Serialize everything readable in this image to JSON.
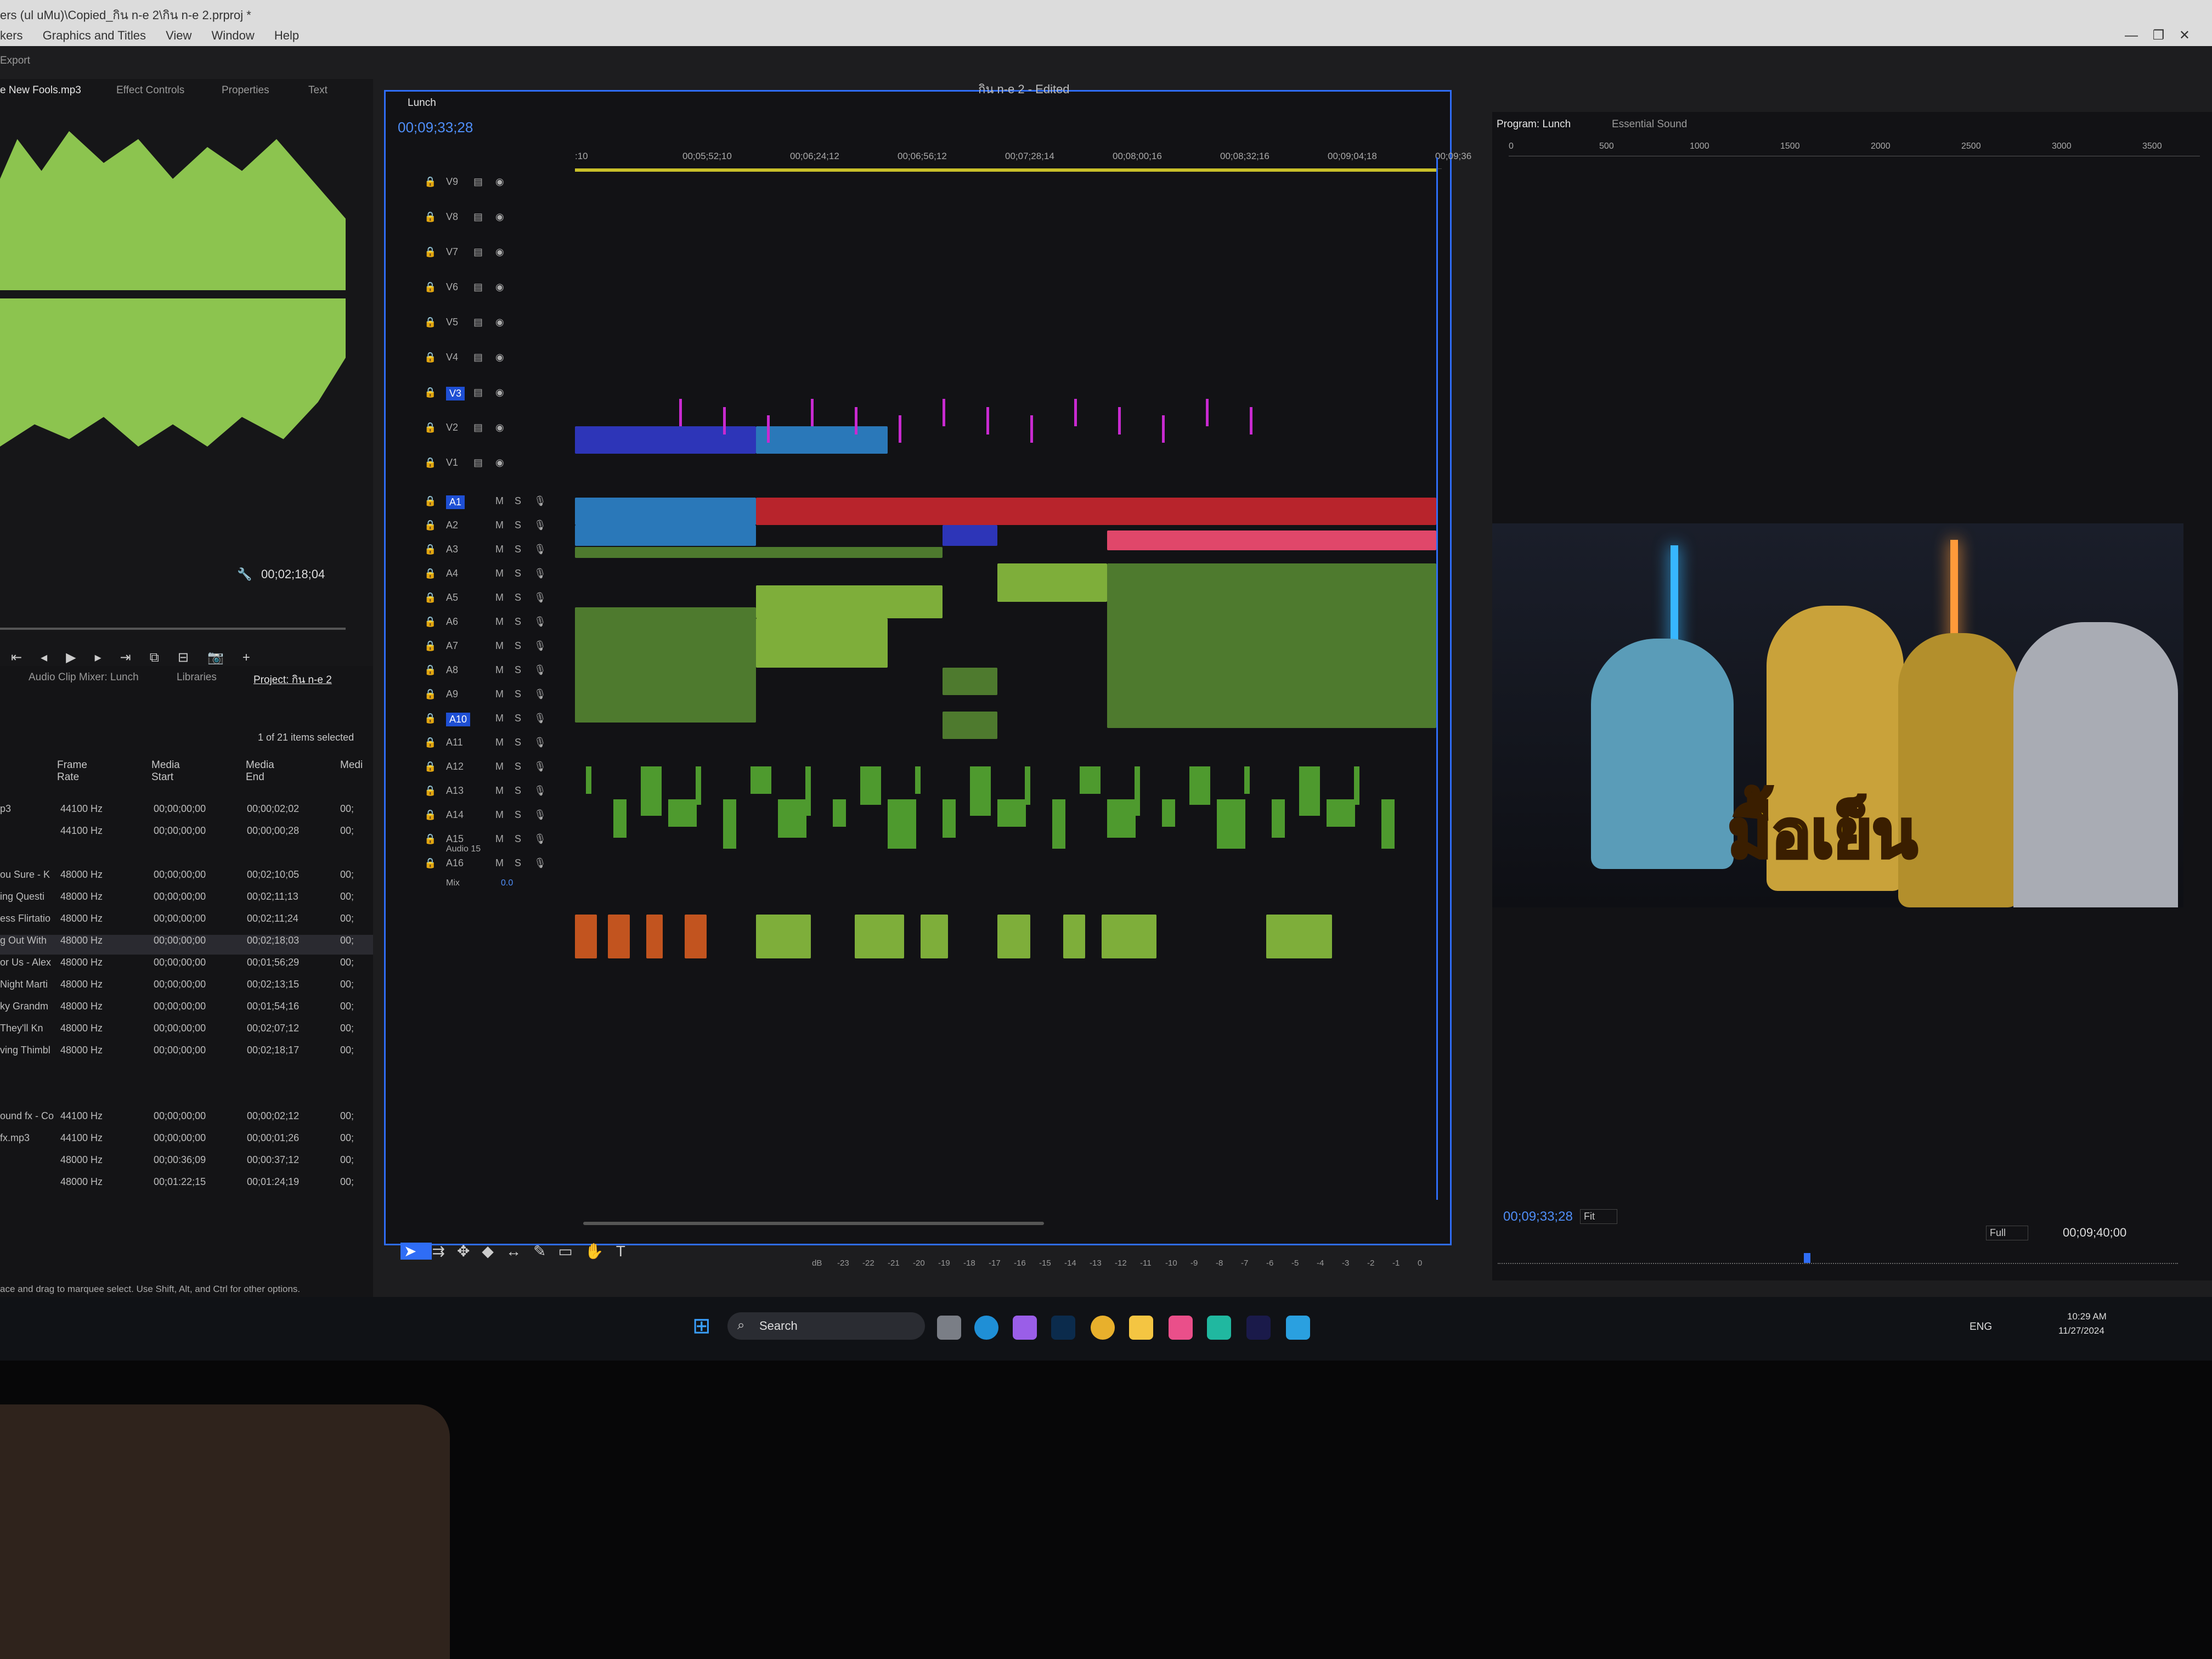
{
  "window": {
    "title": "ers (ul uMu)\\Copied_กิน n-e 2\\กิน n-e 2.prproj *",
    "menus": [
      "kers",
      "Graphics and Titles",
      "View",
      "Window",
      "Help"
    ],
    "export_label": "Export"
  },
  "source_panel": {
    "tabs": [
      "e New Fools.mp3",
      "Effect Controls",
      "Properties",
      "Text"
    ],
    "timecode": "00;02;18;04"
  },
  "timeline": {
    "tab": "Lunch",
    "title": "กิน n-e 2 - Edited",
    "timecode": "00;09;33;28",
    "ruler": [
      ":10",
      "00;05;52;10",
      "00;06;24;12",
      "00;06;56;12",
      "00;07;28;14",
      "00;08;00;16",
      "00;08;32;16",
      "00;09;04;18",
      "00;09;36"
    ],
    "video_tracks": [
      "V9",
      "V8",
      "V7",
      "V6",
      "V5",
      "V4",
      "V3",
      "V2",
      "V1"
    ],
    "audio_tracks": [
      "A1",
      "A2",
      "A3",
      "A4",
      "A5",
      "A6",
      "A7",
      "A8",
      "A9",
      "A10",
      "A11",
      "A12",
      "A13",
      "A14",
      "A15",
      "A16"
    ],
    "audio15_name": "Audio 15",
    "mix_label": "Mix",
    "mix_value": "0.0",
    "ms": [
      "M",
      "S"
    ]
  },
  "program": {
    "tabs": [
      "Program: Lunch",
      "Essential Sound"
    ],
    "ruler": [
      "0",
      "500",
      "1000",
      "1500",
      "2000",
      "2500",
      "3000",
      "3500"
    ],
    "timecode": "00;09;33;28",
    "fit": "Fit",
    "resolution": "Full",
    "duration": "00;09;40;00",
    "overlay_text": "มื้อเย็น"
  },
  "project": {
    "tabs": [
      "Audio Clip Mixer: Lunch",
      "Libraries",
      "Project: กิน n-e 2"
    ],
    "selection": "1 of 21 items selected",
    "columns": [
      "Frame Rate",
      "Media Start",
      "Media End",
      "Medi"
    ],
    "rows": [
      {
        "name": "p3",
        "rate": "44100 Hz",
        "start": "00;00;00;00",
        "end": "00;00;02;02",
        "x": "00;"
      },
      {
        "name": "",
        "rate": "44100 Hz",
        "start": "00;00;00;00",
        "end": "00;00;00;28",
        "x": "00;"
      },
      {
        "name": "ou Sure - K",
        "rate": "48000 Hz",
        "start": "00;00;00;00",
        "end": "00;02;10;05",
        "x": "00;"
      },
      {
        "name": "ing Questi",
        "rate": "48000 Hz",
        "start": "00;00;00;00",
        "end": "00;02;11;13",
        "x": "00;"
      },
      {
        "name": "ess Flirtatio",
        "rate": "48000 Hz",
        "start": "00;00;00;00",
        "end": "00;02;11;24",
        "x": "00;"
      },
      {
        "name": "g Out With",
        "rate": "48000 Hz",
        "start": "00;00;00;00",
        "end": "00;02;18;03",
        "x": "00;"
      },
      {
        "name": "or Us - Alex",
        "rate": "48000 Hz",
        "start": "00;00;00;00",
        "end": "00;01;56;29",
        "x": "00;"
      },
      {
        "name": "Night Marti",
        "rate": "48000 Hz",
        "start": "00;00;00;00",
        "end": "00;02;13;15",
        "x": "00;"
      },
      {
        "name": "ky Grandm",
        "rate": "48000 Hz",
        "start": "00;00;00;00",
        "end": "00;01;54;16",
        "x": "00;"
      },
      {
        "name": "They'll Kn",
        "rate": "48000 Hz",
        "start": "00;00;00;00",
        "end": "00;02;07;12",
        "x": "00;"
      },
      {
        "name": "ving Thimbl",
        "rate": "48000 Hz",
        "start": "00;00;00;00",
        "end": "00;02;18;17",
        "x": "00;"
      },
      {
        "name": "ound fx - Co",
        "rate": "44100 Hz",
        "start": "00;00;00;00",
        "end": "00;00;02;12",
        "x": "00;"
      },
      {
        "name": "fx.mp3",
        "rate": "44100 Hz",
        "start": "00;00;00;00",
        "end": "00;00;01;26",
        "x": "00;"
      },
      {
        "name": "",
        "rate": "48000 Hz",
        "start": "00;00:36;09",
        "end": "00;00:37;12",
        "x": "00;"
      },
      {
        "name": "",
        "rate": "48000 Hz",
        "start": "00;01:22;15",
        "end": "00;01:24;19",
        "x": "00;"
      }
    ]
  },
  "meter_scale": [
    "dB",
    "-23",
    "-22",
    "-21",
    "-20",
    "-19",
    "-18",
    "-17",
    "-16",
    "-15",
    "-14",
    "-13",
    "-12",
    "-11",
    "-10",
    "-9",
    "-8",
    "-7",
    "-6",
    "-5",
    "-4",
    "-3",
    "-2",
    "-1",
    "0"
  ],
  "status_bar": "ace and drag to marquee select. Use Shift, Alt, and Ctrl for other options.",
  "taskbar": {
    "search_placeholder": "Search",
    "lang": "ENG",
    "time": "10:29 AM",
    "date": "11/27/2024"
  },
  "colors": {
    "accent": "#2f6df6",
    "clip_red": "#b8242c",
    "clip_pink": "#e0476a",
    "clip_green": "#4e7a2e",
    "clip_blue": "#2d35b8",
    "overlay_yellow": "#f5d000"
  },
  "icons": [
    "lock-icon",
    "eye-icon",
    "mic-icon",
    "wrench-icon",
    "play-icon",
    "step-back-icon",
    "step-forward-icon",
    "camera-icon",
    "plus-icon",
    "selection-tool-icon",
    "razor-tool-icon",
    "pen-tool-icon",
    "hand-tool-icon",
    "type-tool-icon",
    "search-icon",
    "windows-start-icon"
  ]
}
